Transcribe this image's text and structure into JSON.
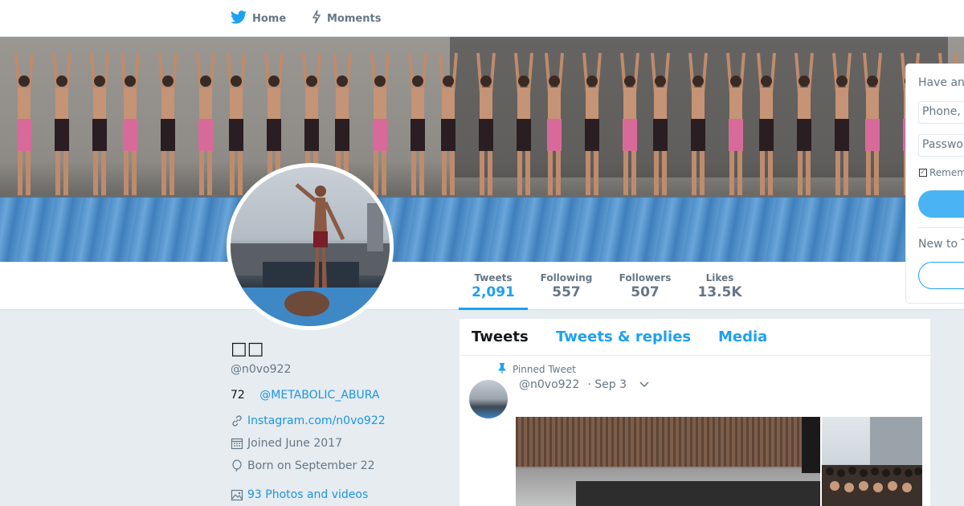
{
  "nav": {
    "home_label": "Home",
    "moments_label": "Moments"
  },
  "stats": [
    {
      "label": "Tweets",
      "value": "2,091",
      "active": true
    },
    {
      "label": "Following",
      "value": "557"
    },
    {
      "label": "Followers",
      "value": "507"
    },
    {
      "label": "Likes",
      "value": "13.5K"
    }
  ],
  "profile": {
    "name": "□□",
    "handle": "@n0vo922",
    "bio_number": "72",
    "bio_mention": "@METABOLIC_ABURA",
    "website": "Instagram.com/n0vo922",
    "joined": "Joined June 2017",
    "born": "Born on September 22",
    "photos": "93 Photos and videos"
  },
  "timeline": {
    "tabs": [
      "Tweets",
      "Tweets & replies",
      "Media"
    ],
    "pinned_label": "Pinned Tweet",
    "tweet_handle": "@n0vo922",
    "tweet_date": "· Sep 3"
  },
  "login": {
    "have_account": "Have an",
    "phone_placeholder": "Phone,",
    "password_placeholder": "Passwor",
    "remember": "Remem",
    "new_to": "New to T"
  },
  "colors": {
    "accent": "#1da1f2",
    "background": "#e6ecf0"
  }
}
